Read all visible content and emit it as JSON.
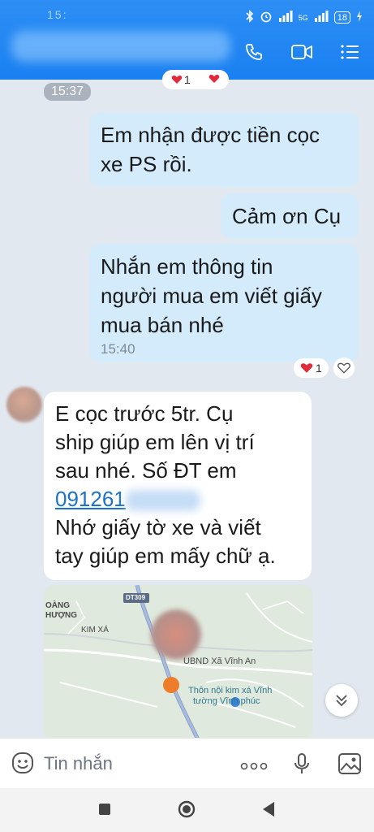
{
  "status": {
    "time_partial": "15:",
    "network": "5G",
    "battery": "18"
  },
  "header": {
    "actions": [
      "phone-icon",
      "video-icon",
      "menu-icon"
    ]
  },
  "messages": {
    "top_reaction": {
      "count": "1"
    },
    "time_divider": "15:37",
    "m1": {
      "text_l1": "Em nhận được tiền cọc",
      "text_l2": "xe PS rồi."
    },
    "m2": {
      "text": "Cảm ơn Cụ"
    },
    "m3": {
      "text_l1": "Nhắn em thông tin",
      "text_l2": "người mua em viết giấy",
      "text_l3": "mua bán nhé",
      "time": "15:40",
      "reaction_count": "1"
    },
    "m4": {
      "text_l1": "E cọc trước 5tr. Cụ",
      "text_l2": "ship giúp em lên vị trí",
      "text_l3": "sau nhé. Số ĐT em",
      "phone": "091261",
      "text_l4": "Nhớ giấy tờ xe và viết",
      "text_l5": "tay giúp em mấy chữ ạ."
    }
  },
  "map": {
    "road": "DT309",
    "label_1a": "OÀNG",
    "label_1b": "HƯỢNG",
    "label_2": "KIM XÁ",
    "poi_1": "UBND Xã Vĩnh An",
    "poi_2a": "Thôn nội kim xá Vĩnh",
    "poi_2b": "tường Vĩnh phúc"
  },
  "composer": {
    "placeholder": "Tin nhắn"
  },
  "colors": {
    "header": "#1a80f1",
    "outgoing_bubble": "#d3ebfb",
    "incoming_bubble": "#ffffff",
    "background": "#e2e8ef",
    "link": "#1a73c9"
  }
}
